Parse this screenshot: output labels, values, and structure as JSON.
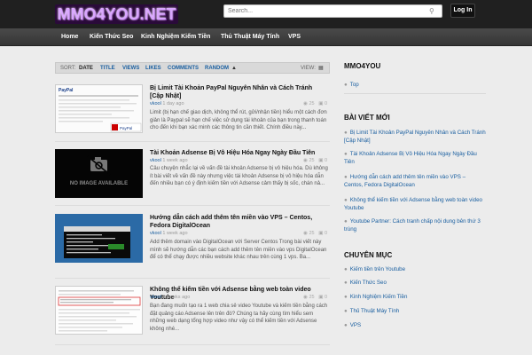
{
  "header": {
    "logo_text": "MMO4YOU.NET",
    "search_placeholder": "Search...",
    "login_label": "Log In"
  },
  "nav": [
    "Home",
    "Kiến Thức Seo",
    "Kinh Nghiệm Kiếm Tiền",
    "Thủ Thuật Máy Tính",
    "VPS"
  ],
  "sortbar": {
    "label": "SORT:",
    "items": [
      "DATE",
      "TITLE",
      "VIEWS",
      "LIKES",
      "COMMENTS",
      "RANDOM"
    ],
    "view_label": "VIEW:"
  },
  "posts": [
    {
      "title": "Bị Limit Tài Khoản PayPal Nguyên Nhân và Cách Tránh [Cập Nhật]",
      "author": "vkool",
      "time": "1 day ago",
      "views": "25",
      "comments": "0",
      "excerpt": "Limit (bị hạn chế giao dịch, không thể rút, gửi/nhận tiền) hiểu một cách đơn giản là Paypal sẽ hạn chế việc sử dụng tài khoản của bạn trong thanh toán cho đến khi bạn xác minh các thông tin cần thiết. Chính điều này..."
    },
    {
      "title": "Tài Khoản Adsense Bị Vô Hiệu Hóa Ngay Ngày Đầu Tiên",
      "author": "vkool",
      "time": "1 week ago",
      "views": "25",
      "comments": "0",
      "thumb_text": "NO IMAGE AVAILABLE",
      "excerpt": "Câu chuyện nhắc lại về vấn đề tài khoản Adsense bị vô hiệu hóa. Dù không ít bài viết về vấn đề này nhưng việc tài khoản Adsense bị vô hiệu hóa dẫn đến nhiều bạn có ý định kiếm tiền với Adsense cảm thấy bị sốc, chán nả..."
    },
    {
      "title": "Hướng dẫn cách add thêm tên miền vào VPS – Centos, Fedora DigitalOcean",
      "author": "vkool",
      "time": "1 week ago",
      "views": "25",
      "comments": "0",
      "excerpt": "Add thêm domain vào DigitalOcean với Server Centos   Trong bài viết này mình sẽ hướng dẫn các bạn cách add thêm tên miền vào vps DigitalOcean để có thể chạy được nhiều website khác nhau trên cùng 1 vps. Ba..."
    },
    {
      "title": "Không thể kiếm tiền với Adsense bằng web toàn video Youtube",
      "author": "vkool",
      "time": "2 weeks ago",
      "views": "25",
      "comments": "0",
      "excerpt": "Bạn đang muốn tạo ra 1 web chia sẻ video Youtube và kiếm tiền bằng cách đặt quảng cáo Adsense lên trên đó? Chúng ta hãy cùng tìm hiểu sem những web dạng tổng hợp video như vậy có thể kiếm tiền với Adsense không nhé..."
    }
  ],
  "sidebar": {
    "section1_title": "MMO4YOU",
    "section1_links": [
      "Top"
    ],
    "section2_title": "BÀI VIẾT MỚI",
    "section2_links": [
      "Bị Limit Tài Khoản PayPal Nguyên Nhân và Cách Tránh [Cập Nhật]",
      "Tài Khoản Adsense Bị Vô Hiệu Hóa Ngay Ngày Đầu Tiên",
      "Hướng dẫn cách add thêm tên miền vào VPS – Centos, Fedora DigitalOcean",
      "Không thể kiếm tiền với Adsense bằng web toàn video Youtube",
      "Youtube Partner: Cách tranh chấp nội dung bên thứ 3 trùng"
    ],
    "section3_title": "CHUYÊN MỤC",
    "section3_links": [
      "Kiếm tiền trên Youtube",
      "Kiến Thức Seo",
      "Kinh Nghiệm Kiếm Tiền",
      "Thủ Thuật Máy Tính",
      "VPS"
    ]
  },
  "colors": {
    "link": "#1a5fa0",
    "topbar": "#202020",
    "navbar": "#3e3e3e"
  }
}
